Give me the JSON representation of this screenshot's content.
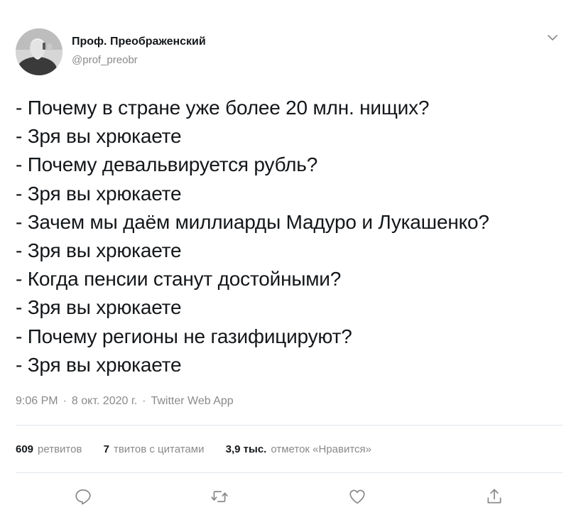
{
  "author": {
    "name": "Проф. Преображенский",
    "handle": "@prof_preobr"
  },
  "tweet": {
    "lines": [
      "- Почему в стране уже более 20 млн. нищих?",
      "- Зря вы хрюкаете",
      "- Почему девальвируется рубль?",
      "- Зря вы хрюкаете",
      "- Зачем мы даём миллиарды Мадуро и Лукашенко?",
      "- Зря вы хрюкаете",
      "- Когда пенсии станут достойными?",
      "- Зря вы хрюкаете",
      "- Почему регионы не газифицируют?",
      "- Зря вы хрюкаете"
    ]
  },
  "meta": {
    "time": "9:06 PM",
    "date": "8 окт. 2020 г.",
    "source": "Twitter Web App",
    "separator": "·"
  },
  "stats": {
    "retweets_count": "609",
    "retweets_label": "ретвитов",
    "quotes_count": "7",
    "quotes_label": "твитов с цитатами",
    "likes_count": "3,9 тыс.",
    "likes_label": "отметок «Нравится»"
  },
  "icons": {
    "caret": "chevron-down-icon",
    "reply": "reply-icon",
    "retweet": "retweet-icon",
    "like": "heart-icon",
    "share": "share-icon"
  },
  "colors": {
    "text": "#14171a",
    "muted": "#8a8a8a",
    "divider": "#e1e8ed"
  }
}
